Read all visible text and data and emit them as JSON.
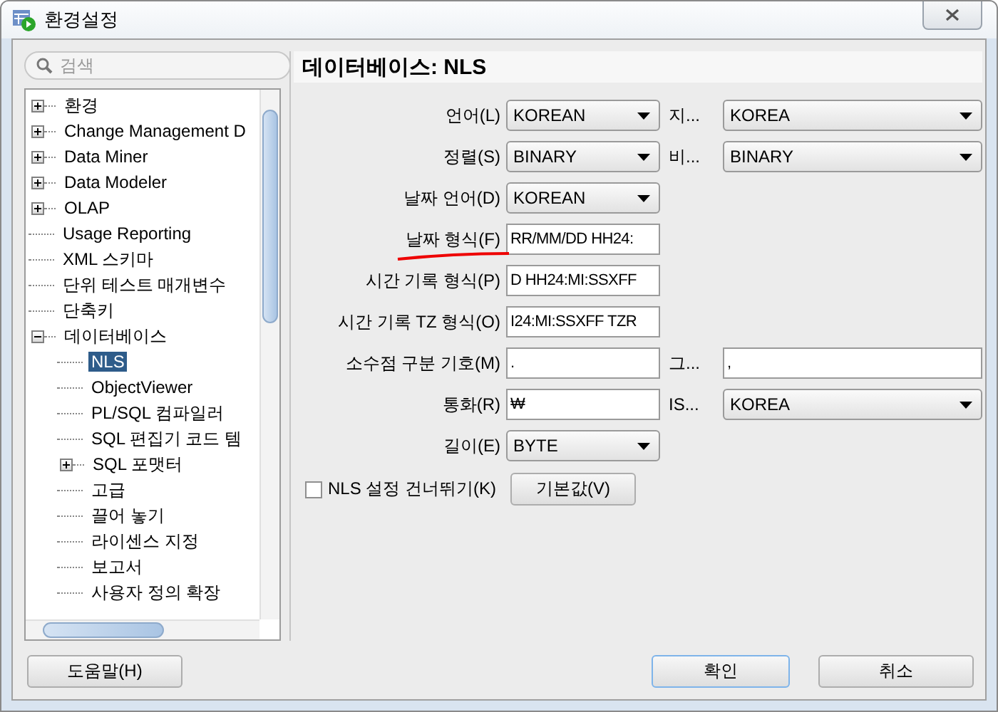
{
  "window": {
    "title": "환경설정"
  },
  "search": {
    "placeholder": "검색"
  },
  "tree": [
    {
      "label": "환경",
      "kind": "group",
      "expanded": false,
      "selected": false
    },
    {
      "label": "Change Management D",
      "kind": "group",
      "expanded": false,
      "selected": false
    },
    {
      "label": "Data Miner",
      "kind": "group",
      "expanded": false,
      "selected": false
    },
    {
      "label": "Data Modeler",
      "kind": "group",
      "expanded": false,
      "selected": false
    },
    {
      "label": "OLAP",
      "kind": "group",
      "expanded": false,
      "selected": false
    },
    {
      "label": "Usage Reporting",
      "kind": "leaf",
      "selected": false
    },
    {
      "label": "XML 스키마",
      "kind": "leaf",
      "selected": false
    },
    {
      "label": "단위 테스트 매개변수",
      "kind": "leaf",
      "selected": false
    },
    {
      "label": "단축키",
      "kind": "leaf",
      "selected": false
    },
    {
      "label": "데이터베이스",
      "kind": "group",
      "expanded": true,
      "selected": false,
      "children": [
        {
          "label": "NLS",
          "kind": "leaf",
          "selected": true
        },
        {
          "label": "ObjectViewer",
          "kind": "leaf",
          "selected": false
        },
        {
          "label": "PL/SQL 컴파일러",
          "kind": "leaf",
          "selected": false
        },
        {
          "label": "SQL 편집기 코드 템",
          "kind": "leaf",
          "selected": false
        },
        {
          "label": "SQL 포맷터",
          "kind": "group",
          "expanded": false,
          "selected": false
        },
        {
          "label": "고급",
          "kind": "leaf",
          "selected": false
        },
        {
          "label": "끌어 놓기",
          "kind": "leaf",
          "selected": false
        },
        {
          "label": "라이센스 지정",
          "kind": "leaf",
          "selected": false
        },
        {
          "label": "보고서",
          "kind": "leaf",
          "selected": false
        },
        {
          "label": "사용자 정의 확장",
          "kind": "leaf",
          "selected": false
        }
      ]
    }
  ],
  "panel": {
    "title": "데이터베이스: NLS"
  },
  "rows": [
    {
      "label": "언어(L)",
      "field": {
        "kind": "select",
        "value": "KOREAN"
      },
      "second": {
        "label": "지...",
        "kind": "select",
        "value": "KOREA"
      }
    },
    {
      "label": "정렬(S)",
      "field": {
        "kind": "select",
        "value": "BINARY"
      },
      "second": {
        "label": "비...",
        "kind": "select",
        "value": "BINARY"
      }
    },
    {
      "label": "날짜 언어(D)",
      "field": {
        "kind": "select",
        "value": "KOREAN"
      }
    },
    {
      "label": "날짜 형식(F)",
      "highlighted": true,
      "field": {
        "kind": "text",
        "value": "RR/MM/DD HH24:"
      }
    },
    {
      "label": "시간 기록 형식(P)",
      "field": {
        "kind": "text",
        "value": "D HH24:MI:SSXFF"
      }
    },
    {
      "label": "시간 기록 TZ 형식(O)",
      "field": {
        "kind": "text",
        "value": "I24:MI:SSXFF TZR"
      }
    },
    {
      "label": "소수점 구분 기호(M)",
      "field": {
        "kind": "text",
        "value": "."
      },
      "second": {
        "label": "그...",
        "kind": "text",
        "value": ","
      }
    },
    {
      "label": "통화(R)",
      "field": {
        "kind": "text",
        "value": "₩"
      },
      "second": {
        "label": "IS...",
        "kind": "select",
        "value": "KOREA"
      }
    },
    {
      "label": "길이(E)",
      "field": {
        "kind": "select",
        "value": "BYTE"
      }
    }
  ],
  "skip": {
    "label": "NLS 설정 건너뛰기(K)",
    "checked": false
  },
  "defaults_button": "기본값(V)",
  "buttons": {
    "help": "도움말(H)",
    "ok": "확인",
    "cancel": "취소"
  }
}
